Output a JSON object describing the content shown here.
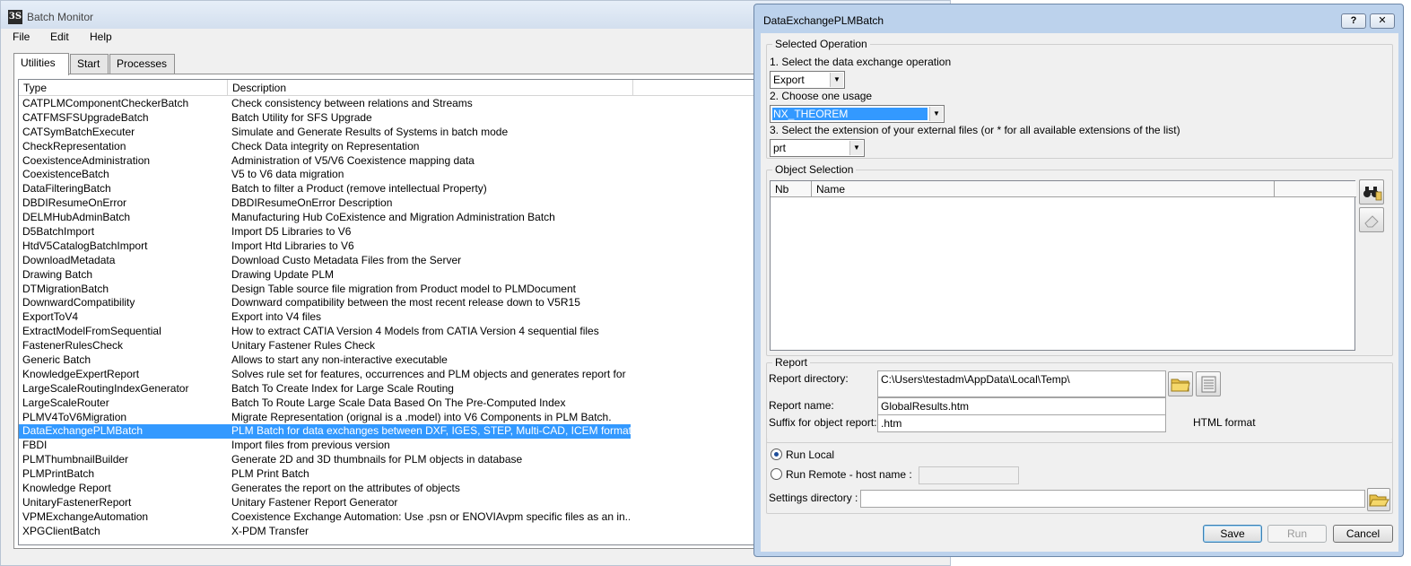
{
  "monitor": {
    "title": "Batch Monitor",
    "menu": {
      "file": "File",
      "edit": "Edit",
      "help": "Help"
    },
    "tabs": [
      "Utilities",
      "Start",
      "Processes"
    ],
    "columns": {
      "type": "Type",
      "description": "Description"
    },
    "rows": [
      {
        "type": "CATPLMComponentCheckerBatch",
        "desc": "Check consistency between relations and Streams"
      },
      {
        "type": "CATFMSFSUpgradeBatch",
        "desc": "Batch Utility for SFS Upgrade"
      },
      {
        "type": "CATSymBatchExecuter",
        "desc": "Simulate and Generate Results of Systems in batch mode"
      },
      {
        "type": "CheckRepresentation",
        "desc": "Check Data integrity on Representation"
      },
      {
        "type": "CoexistenceAdministration",
        "desc": "Administration of V5/V6 Coexistence mapping data"
      },
      {
        "type": "CoexistenceBatch",
        "desc": "V5 to V6 data migration"
      },
      {
        "type": "DataFilteringBatch",
        "desc": "Batch to filter a Product (remove intellectual Property)"
      },
      {
        "type": "DBDIResumeOnError",
        "desc": "DBDIResumeOnError Description"
      },
      {
        "type": "DELMHubAdminBatch",
        "desc": "Manufacturing Hub CoExistence and Migration Administration Batch"
      },
      {
        "type": "D5BatchImport",
        "desc": "Import D5 Libraries to V6"
      },
      {
        "type": "HtdV5CatalogBatchImport",
        "desc": "Import Htd Libraries to V6"
      },
      {
        "type": "DownloadMetadata",
        "desc": "Download Custo Metadata Files from the Server"
      },
      {
        "type": "Drawing Batch",
        "desc": "Drawing Update PLM"
      },
      {
        "type": "DTMigrationBatch",
        "desc": "Design Table source file migration from Product model to PLMDocument"
      },
      {
        "type": "DownwardCompatibility",
        "desc": "Downward compatibility between the most recent release down to V5R15"
      },
      {
        "type": "ExportToV4",
        "desc": "Export into V4 files"
      },
      {
        "type": "ExtractModelFromSequential",
        "desc": "How to extract CATIA Version 4 Models from CATIA Version 4 sequential files"
      },
      {
        "type": "FastenerRulesCheck",
        "desc": "Unitary Fastener Rules Check"
      },
      {
        "type": "Generic Batch",
        "desc": "Allows to start any non-interactive executable"
      },
      {
        "type": "KnowledgeExpertReport",
        "desc": "Solves rule set for features, occurrences and PLM objects and generates report for ..."
      },
      {
        "type": "LargeScaleRoutingIndexGenerator",
        "desc": "Batch To Create Index for Large Scale Routing"
      },
      {
        "type": "LargeScaleRouter",
        "desc": "Batch To Route Large Scale Data Based On The Pre-Computed Index"
      },
      {
        "type": "PLMV4ToV6Migration",
        "desc": "Migrate Representation (orignal is a .model) into V6 Components in PLM Batch."
      },
      {
        "type": "DataExchangePLMBatch",
        "desc": "PLM Batch for data exchanges between DXF, IGES, STEP, Multi-CAD, ICEM format...",
        "selected": true
      },
      {
        "type": "FBDI",
        "desc": "Import files from previous version"
      },
      {
        "type": "PLMThumbnailBuilder",
        "desc": "Generate 2D and 3D thumbnails for PLM objects in database"
      },
      {
        "type": "PLMPrintBatch",
        "desc": "PLM Print Batch"
      },
      {
        "type": "Knowledge Report",
        "desc": "Generates the report on the attributes of objects"
      },
      {
        "type": "UnitaryFastenerReport",
        "desc": "Unitary Fastener Report Generator"
      },
      {
        "type": "VPMExchangeAutomation",
        "desc": "Coexistence Exchange Automation: Use .psn or ENOVIAvpm specific files as an in..."
      },
      {
        "type": "XPGClientBatch",
        "desc": "X-PDM Transfer"
      }
    ]
  },
  "dialog": {
    "title": "DataExchangePLMBatch",
    "help_btn": "?",
    "close_btn": "✕",
    "selected_operation": {
      "group": "Selected Operation",
      "step1": "1. Select the data exchange operation",
      "operation": "Export",
      "step2": "2. Choose one usage",
      "usage": "NX_THEOREM",
      "step3": "3. Select the extension of your external files (or * for all available extensions of the list)",
      "extension": "prt"
    },
    "object_selection": {
      "group": "Object Selection",
      "col_nb": "Nb",
      "col_name": "Name"
    },
    "report": {
      "group": "Report",
      "dir_label": "Report directory:",
      "dir_value": "C:\\Users\\testadm\\AppData\\Local\\Temp\\",
      "name_label": "Report name:",
      "name_value": "GlobalResults.htm",
      "suffix_label": "Suffix for object report:",
      "suffix_value": ".htm",
      "format": "HTML format"
    },
    "run": {
      "local": "Run Local",
      "remote": "Run Remote - host name :",
      "host": ""
    },
    "settings": {
      "label": "Settings directory :",
      "value": ""
    },
    "buttons": {
      "save": "Save",
      "run": "Run",
      "cancel": "Cancel"
    }
  }
}
